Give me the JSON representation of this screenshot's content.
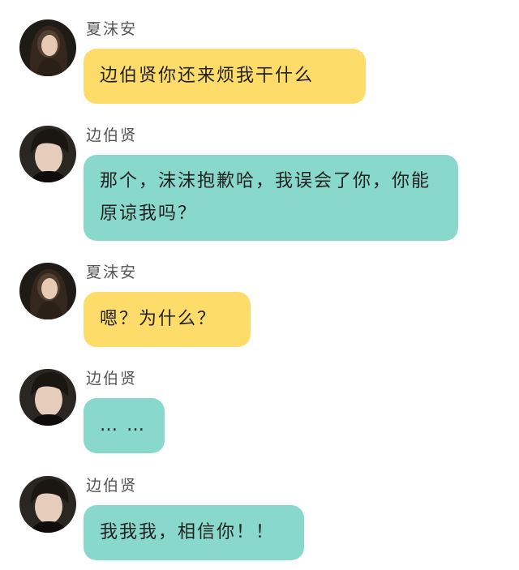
{
  "messages": [
    {
      "sender": "夏沫安",
      "avatar": "girl-avatar",
      "color": "#fddc6a",
      "text": "边伯贤你还来烦我干什么"
    },
    {
      "sender": "边伯贤",
      "avatar": "boy-avatar",
      "color": "#88d8cb",
      "text": "那个，沫沫抱歉哈，我误会了你，你能原谅我吗？"
    },
    {
      "sender": "夏沫安",
      "avatar": "girl-avatar",
      "color": "#fddc6a",
      "text": "嗯？为什么？"
    },
    {
      "sender": "边伯贤",
      "avatar": "boy-avatar",
      "color": "#88d8cb",
      "text": "…  …"
    },
    {
      "sender": "边伯贤",
      "avatar": "boy-avatar",
      "color": "#88d8cb",
      "text": "我我我，相信你！！"
    }
  ]
}
